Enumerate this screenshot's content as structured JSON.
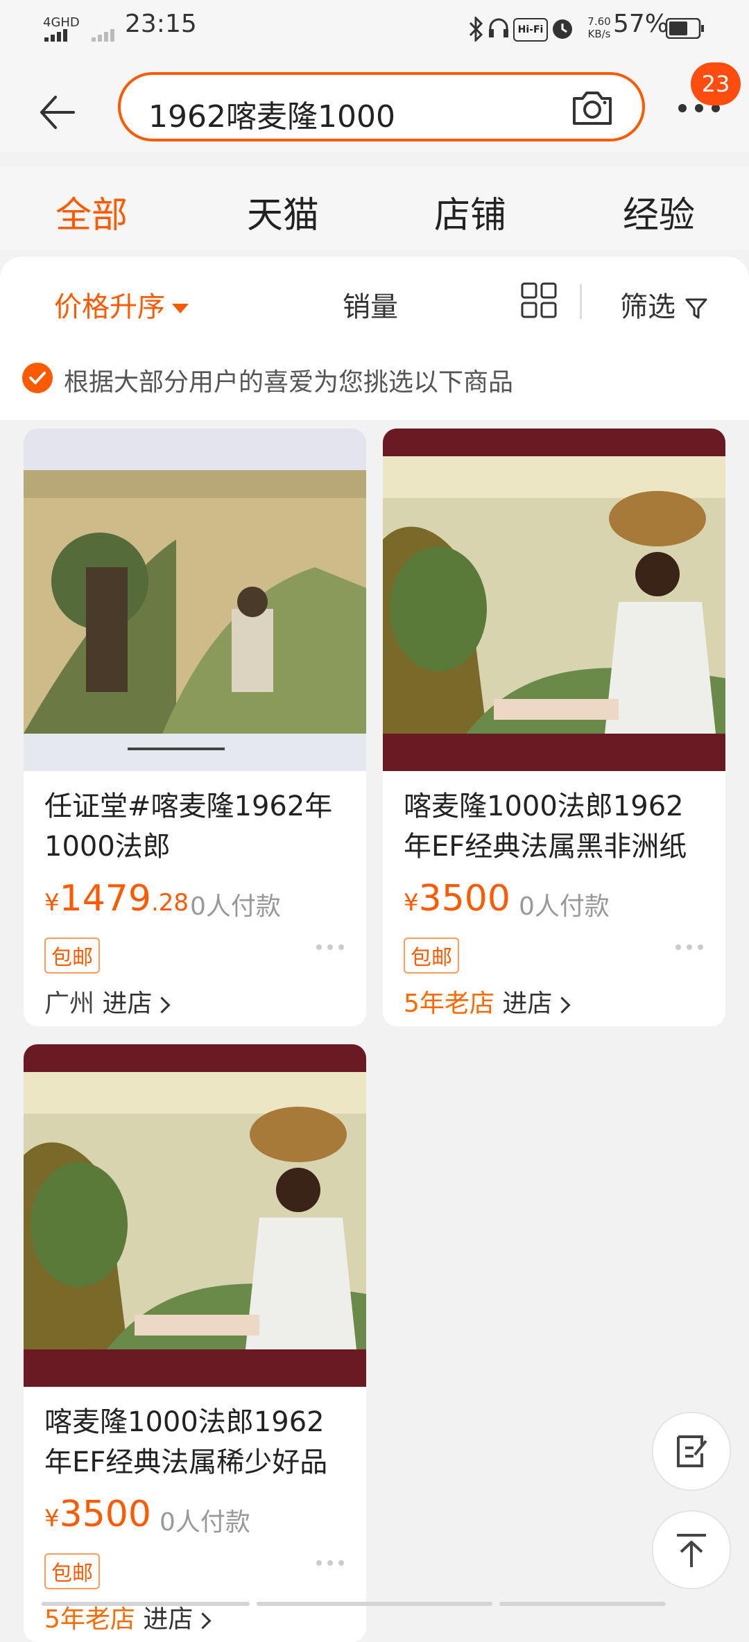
{
  "status_bar": {
    "network": "4GHD",
    "time": "23:15",
    "speed": "7.60 KB/s",
    "battery": "57%",
    "icons": [
      "bluetooth-icon",
      "headphones-icon",
      "hifi-icon",
      "alarm-icon"
    ]
  },
  "search": {
    "query": "1962喀麦隆1000",
    "notification_count": "23"
  },
  "tabs": [
    {
      "label": "全部",
      "active": true
    },
    {
      "label": "天猫",
      "active": false
    },
    {
      "label": "店铺",
      "active": false
    },
    {
      "label": "经验",
      "active": false
    }
  ],
  "filters": {
    "price_sort": "价格升序",
    "sales": "销量",
    "filter": "筛选"
  },
  "notice": "根据大部分用户的喜爱为您挑选以下商品",
  "products": [
    {
      "title": "任证堂#喀麦隆1962年1000法郎",
      "price_symbol": "¥",
      "price_int": "1479",
      "price_dec": ".28",
      "paid": "0人付款",
      "tag": "包邮",
      "location": "广州",
      "shop_link": "进店"
    },
    {
      "title": "喀麦隆1000法郎1962年EF经典法属黑非洲纸",
      "price_symbol": "¥",
      "price_int": "3500",
      "price_dec": "",
      "paid": "0人付款",
      "tag": "包邮",
      "location": "5年老店",
      "shop_link": "进店"
    },
    {
      "title": "喀麦隆1000法郎1962年EF经典法属稀少好品",
      "price_symbol": "¥",
      "price_int": "3500",
      "price_dec": "",
      "paid": "0人付款",
      "tag": "包邮",
      "location": "5年老店",
      "shop_link": "进店"
    }
  ],
  "colors": {
    "accent": "#ff5a00",
    "background": "#f2f2f2"
  }
}
